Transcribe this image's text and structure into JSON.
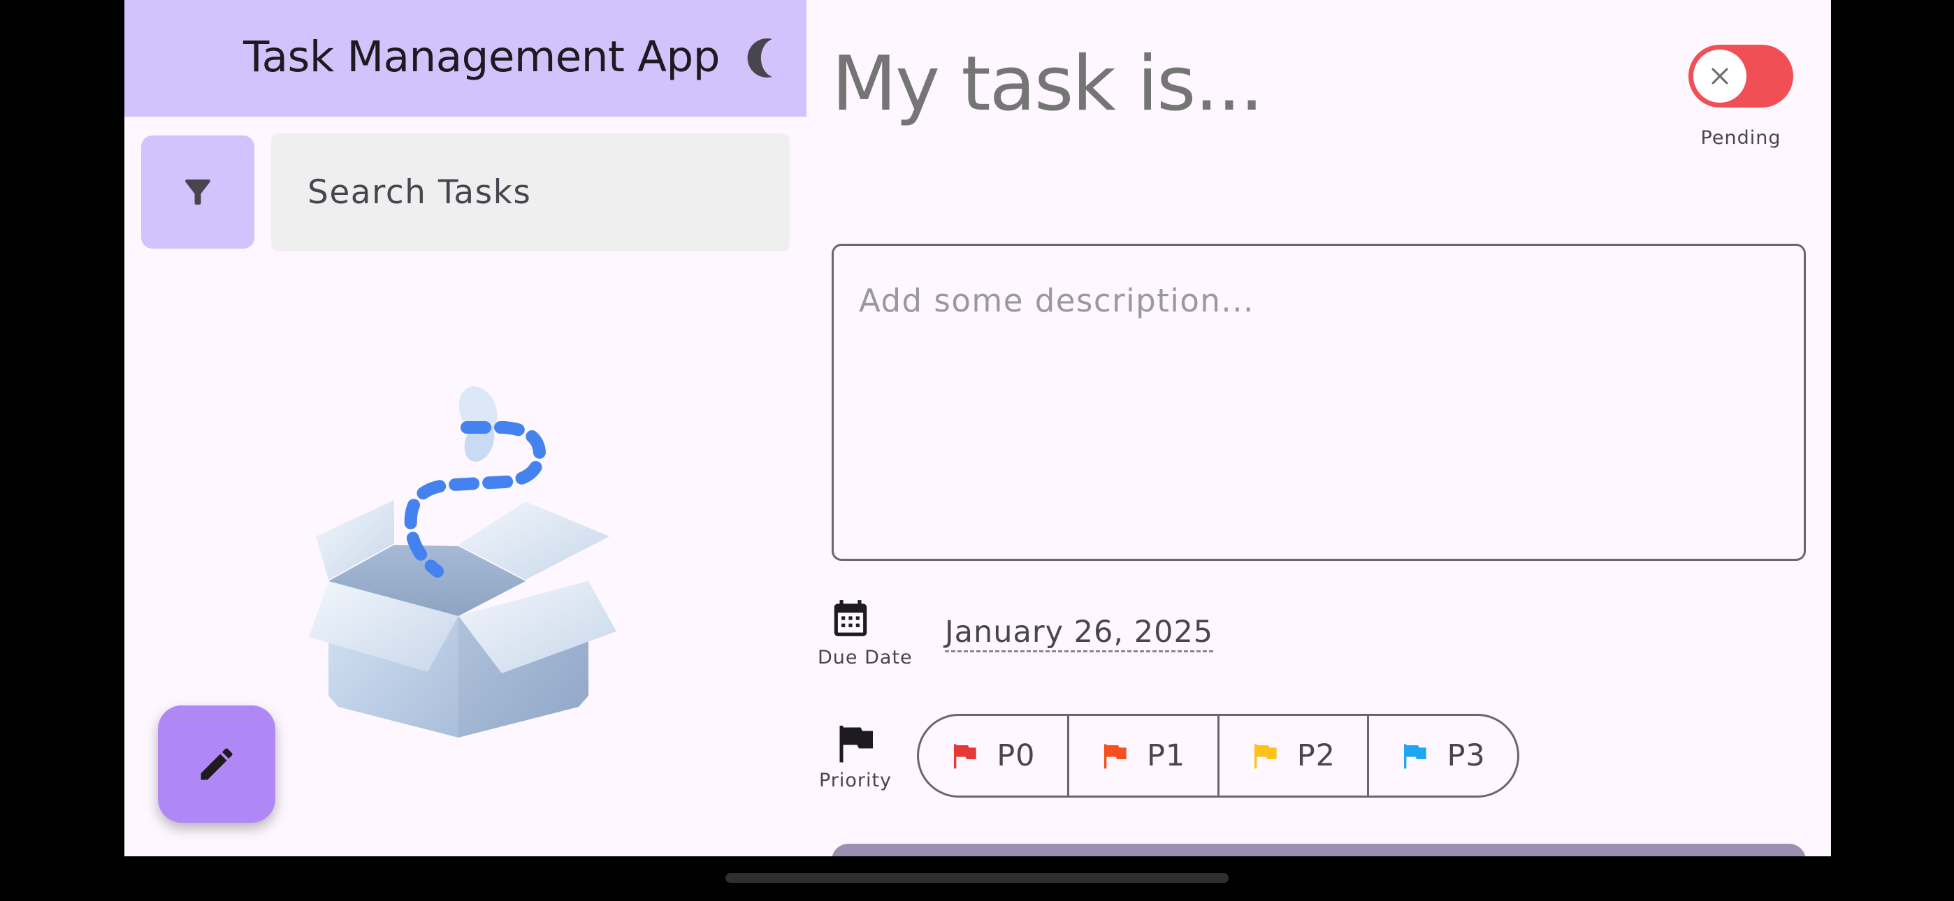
{
  "app": {
    "title": "Task Management App",
    "theme_icon": "moon-icon",
    "colors": {
      "app_bar": "#D3C2FC",
      "fab": "#B088F6",
      "background": "#FEF7FF",
      "status_off": "#F05055"
    }
  },
  "sidebar": {
    "filter_icon": "filter-icon",
    "search": {
      "placeholder": "Search Tasks",
      "value": ""
    },
    "empty_state_icon": "empty-box-illustration",
    "fab_icon": "pencil-icon"
  },
  "editor": {
    "title_placeholder": "My task is...",
    "status": {
      "label": "Pending",
      "completed": false,
      "icon": "close-icon"
    },
    "description_placeholder": "Add some description...",
    "due_date": {
      "label": "Due Date",
      "value": "January 26, 2025",
      "icon": "calendar-icon"
    },
    "priority": {
      "label": "Priority",
      "icon": "flag-icon",
      "options": [
        {
          "label": "P0",
          "color": "#E53935"
        },
        {
          "label": "P1",
          "color": "#F4511E"
        },
        {
          "label": "P2",
          "color": "#FDC11C"
        },
        {
          "label": "P3",
          "color": "#1EA7F0"
        }
      ]
    }
  }
}
